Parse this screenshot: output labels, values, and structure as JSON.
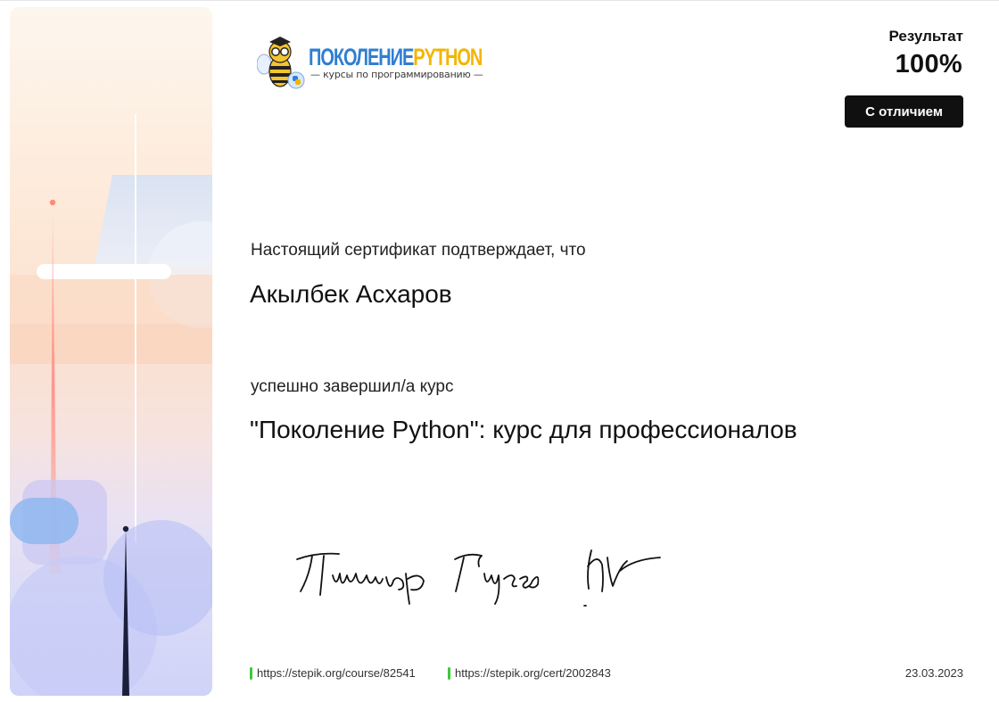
{
  "logo": {
    "title_part1": "ПОКОЛЕНИЕ",
    "title_part2": "PYTHON",
    "subtitle": "— курсы по программированию —"
  },
  "result": {
    "label": "Результат",
    "value": "100%",
    "badge": "С отличием"
  },
  "certificate": {
    "confirm_text": "Настоящий сертификат подтверждает, что",
    "recipient_name": "Акылбек Асхаров",
    "completed_text": "успешно завершил/а  курс",
    "course_name": "\"Поколение Python\": курс для профессионалов"
  },
  "signature": {
    "text": "Тимур Гусев"
  },
  "footer": {
    "course_link": "https://stepik.org/course/82541",
    "cert_link": "https://stepik.org/cert/2002843",
    "date": "23.03.2023"
  },
  "colors": {
    "logo_blue": "#2f7fd2",
    "logo_yellow": "#f2b500",
    "link_marker": "#3dc83d",
    "badge_bg": "#101010"
  }
}
